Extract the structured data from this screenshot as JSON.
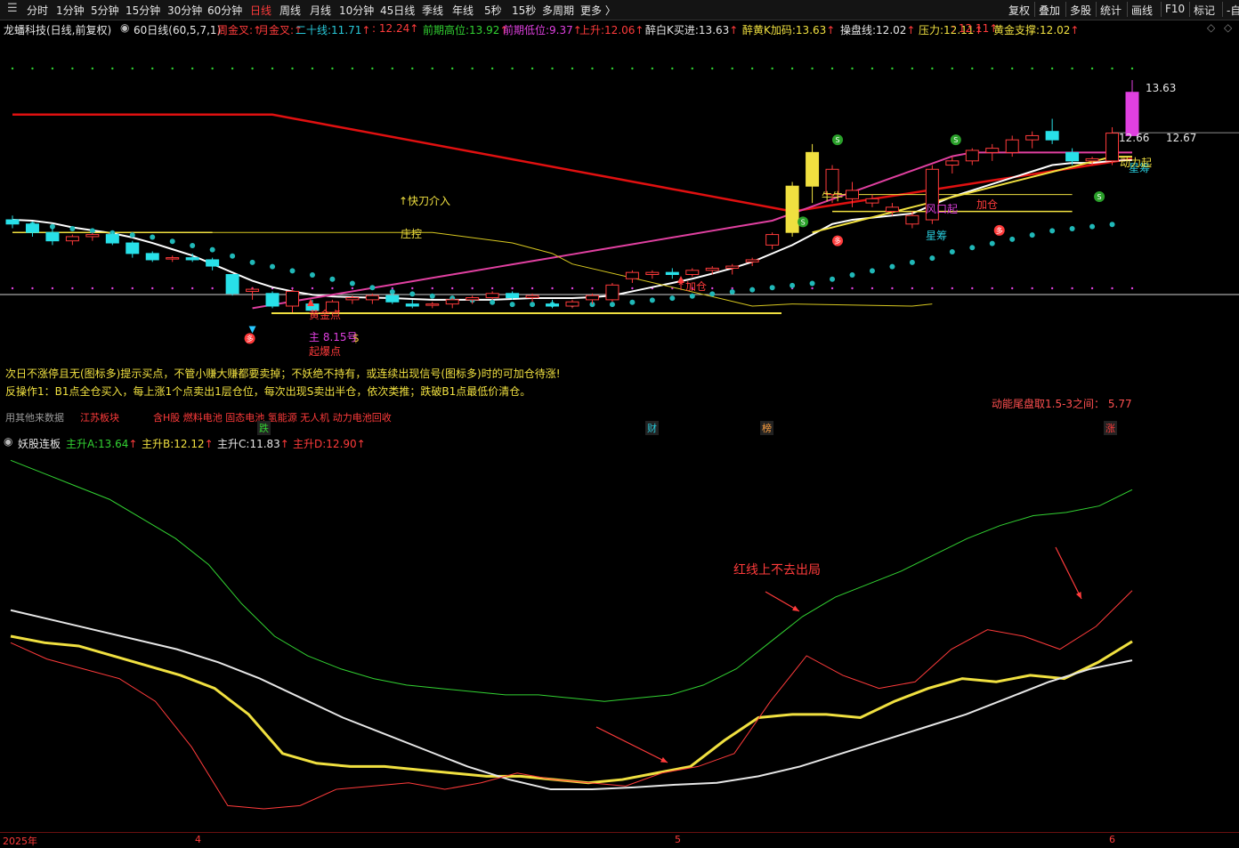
{
  "toolbar": {
    "periods": [
      "分时",
      "1分钟",
      "5分钟",
      "15分钟",
      "30分钟",
      "60分钟",
      "日线",
      "周线",
      "月线",
      "10分钟",
      "45日线",
      "季线",
      "年线",
      "5秒",
      "15秒",
      "多周期",
      "更多 〉"
    ],
    "active_period": "日线",
    "tools": [
      "复权",
      "叠加",
      "多股",
      "统计",
      "画线",
      "F10",
      "标记",
      "-自"
    ]
  },
  "main_legend": {
    "stock": "龙蟠科技(日线,前复权)",
    "ma": "60日线(60,5,7,1)",
    "items": [
      {
        "label": "周金叉:",
        "value": "",
        "color": "#ff3b3b"
      },
      {
        "label": "月金叉:",
        "value": "",
        "color": "#ff3b3b"
      },
      {
        "label": "二十线:",
        "value": "11.71",
        "color": "#28c8d8"
      },
      {
        "label": "",
        "value": ": 12.24",
        "color": "#ff3b3b"
      },
      {
        "label": "前期高位:",
        "value": "13.92",
        "color": "#32d232"
      },
      {
        "label": "前期低位:",
        "value": "9.37",
        "color": "#e040e0"
      },
      {
        "label": "上升:",
        "value": "12.06",
        "color": "#ff3b3b"
      },
      {
        "label": "醉白K买进:",
        "value": "13.63",
        "color": "#e6e6e6"
      },
      {
        "label": "醉黄K加码:",
        "value": "13.63",
        "color": "#f0e040"
      },
      {
        "label": "操盘线:",
        "value": "12.02",
        "color": "#e6e6e6"
      },
      {
        "label": "压力:",
        "value": "12.11",
        "color": "#f0e040"
      },
      {
        "label": "",
        "value": ": 12.11",
        "color": "#ff3b3b"
      },
      {
        "label": "黄金支撑:",
        "value": "12.02",
        "color": "#f0e040"
      }
    ]
  },
  "chart_notes": {
    "hint1": "次日不涨停且无(图标多)提示买点，不管小赚大赚都要卖掉；不妖绝不持有，或连续出现信号(图标多)时的可加仓待涨!",
    "hint2": "反操作1：B1点全仓买入，每上涨1个点卖出1层仓位，每次出现S卖出半仓，依次类推；跌破B1点最低价清仓。",
    "tail_label": "动能尾盘取1.5-3之间：",
    "tail_value": "5.77",
    "data_source_label": "用其他来数据",
    "sector_label": "江苏板块",
    "concepts": "含H股 燃料电池 固态电池 氢能源 无人机 动力电池回收",
    "event_tags": [
      "跌",
      "财",
      "榜",
      "涨"
    ]
  },
  "annotations": {
    "kuaidao": "↑快刀介入",
    "zhuangkong": "庄控",
    "jiacang1": "↑加仓",
    "jiacang2": "加仓",
    "huangjin": "黄金点",
    "dianhao": "主 8.15号",
    "qibao": "起爆点",
    "niuniu": "牛牛",
    "fengkou": "风口起",
    "xingchou": "星筹",
    "xingchou2": "星筹",
    "high": "13.63",
    "price1": "12.66",
    "price2": "12.67",
    "dongli": "动力起"
  },
  "sub_legend": {
    "name": "妖股连板",
    "items": [
      {
        "label": "主升A:",
        "value": "13.64",
        "color": "#32d232"
      },
      {
        "label": "主升B:",
        "value": "12.12",
        "color": "#f0e040"
      },
      {
        "label": "主升C:",
        "value": "11.83",
        "color": "#e6e6e6"
      },
      {
        "label": "主升D:",
        "value": "12.90",
        "color": "#ff3b3b"
      }
    ],
    "note": "红线上不去出局"
  },
  "x_axis": {
    "labels": [
      "2025年",
      "4",
      "5",
      "6"
    ]
  },
  "chart_data": [
    {
      "type": "candlestick",
      "title": "龙蟠科技(日线,前复权)",
      "ohlc_approx": [
        [
          10.6,
          10.7,
          10.4,
          10.5
        ],
        [
          10.5,
          10.55,
          10.2,
          10.3
        ],
        [
          10.3,
          10.4,
          10.0,
          10.1
        ],
        [
          10.1,
          10.25,
          10.0,
          10.2
        ],
        [
          10.2,
          10.3,
          10.1,
          10.25
        ],
        [
          10.25,
          10.3,
          10.0,
          10.05
        ],
        [
          10.05,
          10.1,
          9.7,
          9.8
        ],
        [
          9.8,
          9.85,
          9.6,
          9.65
        ],
        [
          9.7,
          9.75,
          9.6,
          9.7
        ],
        [
          9.7,
          9.8,
          9.6,
          9.65
        ],
        [
          9.65,
          9.7,
          9.4,
          9.5
        ],
        [
          9.3,
          9.3,
          8.8,
          8.85
        ],
        [
          8.9,
          9.0,
          8.7,
          8.95
        ],
        [
          8.85,
          8.9,
          8.5,
          8.55
        ],
        [
          8.55,
          8.95,
          8.4,
          8.9
        ],
        [
          8.6,
          8.7,
          8.4,
          8.45
        ],
        [
          8.4,
          8.7,
          8.35,
          8.65
        ],
        [
          8.7,
          8.8,
          8.6,
          8.75
        ],
        [
          8.7,
          8.85,
          8.6,
          8.8
        ],
        [
          8.8,
          8.85,
          8.6,
          8.65
        ],
        [
          8.6,
          8.7,
          8.5,
          8.55
        ],
        [
          8.6,
          8.65,
          8.5,
          8.6
        ],
        [
          8.6,
          8.75,
          8.5,
          8.7
        ],
        [
          8.7,
          8.8,
          8.6,
          8.75
        ],
        [
          8.75,
          8.9,
          8.7,
          8.85
        ],
        [
          8.85,
          8.9,
          8.7,
          8.75
        ],
        [
          8.75,
          8.85,
          8.65,
          8.8
        ],
        [
          8.6,
          8.7,
          8.5,
          8.55
        ],
        [
          8.55,
          8.7,
          8.5,
          8.65
        ],
        [
          8.7,
          8.85,
          8.6,
          8.8
        ],
        [
          8.7,
          9.1,
          8.65,
          9.05
        ],
        [
          9.2,
          9.4,
          9.1,
          9.35
        ],
        [
          9.3,
          9.4,
          9.2,
          9.35
        ],
        [
          9.35,
          9.45,
          9.2,
          9.3
        ],
        [
          9.3,
          9.45,
          9.25,
          9.4
        ],
        [
          9.4,
          9.5,
          9.3,
          9.45
        ],
        [
          9.45,
          9.55,
          9.3,
          9.5
        ],
        [
          9.6,
          9.7,
          9.5,
          9.65
        ],
        [
          10.0,
          10.3,
          9.9,
          10.25
        ],
        [
          10.3,
          11.5,
          10.2,
          11.4
        ],
        [
          11.4,
          12.4,
          11.0,
          12.2
        ],
        [
          11.2,
          11.9,
          11.0,
          11.8
        ],
        [
          11.1,
          11.5,
          10.9,
          11.3
        ],
        [
          11.0,
          11.2,
          10.9,
          11.1
        ],
        [
          10.8,
          11.0,
          10.7,
          10.9
        ],
        [
          10.5,
          10.8,
          10.4,
          10.7
        ],
        [
          10.6,
          11.9,
          10.5,
          11.8
        ],
        [
          11.9,
          12.1,
          11.7,
          12.0
        ],
        [
          12.0,
          12.3,
          11.9,
          12.25
        ],
        [
          12.2,
          12.4,
          12.0,
          12.3
        ],
        [
          12.2,
          12.6,
          12.1,
          12.5
        ],
        [
          12.5,
          12.7,
          12.3,
          12.6
        ],
        [
          12.7,
          13.0,
          12.4,
          12.5
        ],
        [
          12.2,
          12.3,
          11.9,
          12.0
        ],
        [
          12.0,
          12.1,
          11.9,
          12.05
        ],
        [
          12.0,
          12.8,
          11.9,
          12.66
        ],
        [
          12.6,
          13.92,
          12.6,
          13.63
        ]
      ],
      "lines": [
        {
          "name": "二十线",
          "value": 11.71
        },
        {
          "name": "操盘线",
          "value": 12.02
        },
        {
          "name": "压力",
          "value": 12.11
        },
        {
          "name": "黄金支撑",
          "value": 12.02
        }
      ]
    },
    {
      "type": "line",
      "title": "妖股连板",
      "series": [
        {
          "name": "主升A",
          "color": "#32d232",
          "values": [
            14.9,
            14.7,
            14.5,
            14.3,
            14.0,
            13.7,
            13.3,
            12.7,
            12.2,
            11.9,
            11.7,
            11.55,
            11.45,
            11.4,
            11.35,
            11.3,
            11.3,
            11.25,
            11.2,
            11.25,
            11.3,
            11.45,
            11.7,
            12.1,
            12.5,
            12.8,
            13.0,
            13.2,
            13.45,
            13.7,
            13.9,
            14.05,
            14.1,
            14.2,
            14.45
          ]
        },
        {
          "name": "主升B",
          "color": "#f0e040",
          "values": [
            12.2,
            12.1,
            12.05,
            11.9,
            11.75,
            11.6,
            11.4,
            11.0,
            10.4,
            10.25,
            10.2,
            10.2,
            10.15,
            10.1,
            10.05,
            10.05,
            10.0,
            9.95,
            10.0,
            10.1,
            10.2,
            10.6,
            10.95,
            11.0,
            11.0,
            10.95,
            11.2,
            11.4,
            11.55,
            11.5,
            11.6,
            11.55,
            11.8,
            12.12
          ]
        },
        {
          "name": "主升C",
          "color": "#e6e6e6",
          "values": [
            12.6,
            12.45,
            12.3,
            12.15,
            12.0,
            11.8,
            11.55,
            11.25,
            10.95,
            10.7,
            10.45,
            10.2,
            10.0,
            9.85,
            9.85,
            9.88,
            9.92,
            9.95,
            10.05,
            10.2,
            10.4,
            10.6,
            10.8,
            11.0,
            11.25,
            11.5,
            11.7,
            11.83
          ]
        },
        {
          "name": "主升D",
          "color": "#ff3b3b",
          "values": [
            12.1,
            11.85,
            11.7,
            11.55,
            11.2,
            10.5,
            9.6,
            9.55,
            9.6,
            9.85,
            9.9,
            9.95,
            9.85,
            9.95,
            10.1,
            10.0,
            9.95,
            9.9,
            10.1,
            10.2,
            10.4,
            11.2,
            11.9,
            11.6,
            11.4,
            11.5,
            12.0,
            12.3,
            12.2,
            12.0,
            12.35,
            12.9
          ]
        }
      ]
    }
  ]
}
